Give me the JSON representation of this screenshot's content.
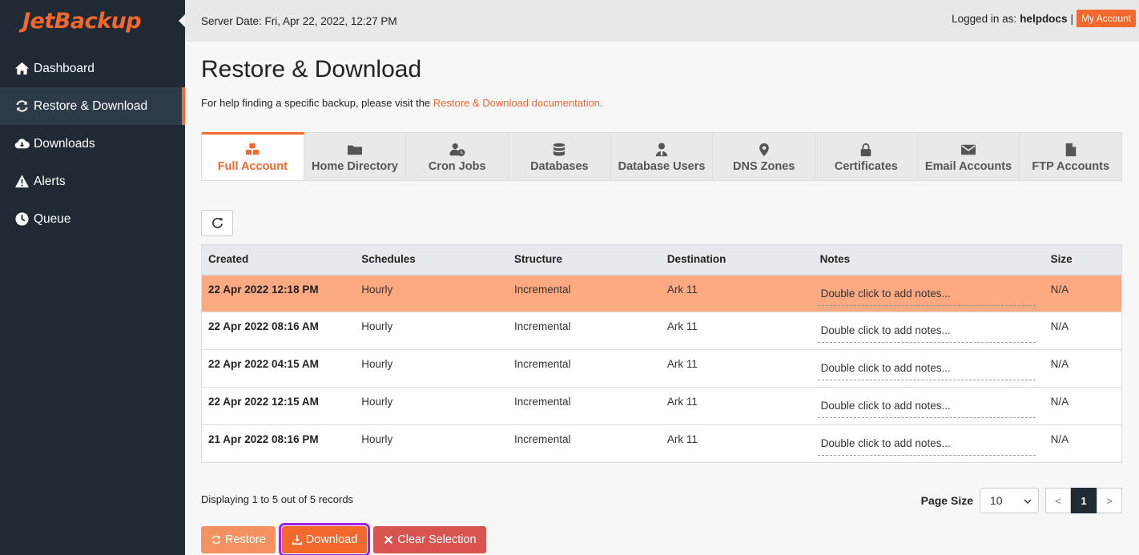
{
  "logo": "JetBackup",
  "sidebar": {
    "items": [
      {
        "label": "Dashboard",
        "icon": "home-icon"
      },
      {
        "label": "Restore & Download",
        "icon": "refresh-icon",
        "active": true
      },
      {
        "label": "Downloads",
        "icon": "cloud-download-icon"
      },
      {
        "label": "Alerts",
        "icon": "warning-icon"
      },
      {
        "label": "Queue",
        "icon": "clock-icon"
      }
    ]
  },
  "topbar": {
    "server_date": "Server Date: Fri, Apr 22, 2022, 12:27 PM",
    "logged_in_label": "Logged in as:",
    "username": "helpdocs",
    "separator": "|",
    "my_account": "My Account"
  },
  "page": {
    "title": "Restore & Download",
    "help_text": "For help finding a specific backup, please visit the",
    "help_link": "Restore & Download documentation."
  },
  "tabs": [
    {
      "label": "Full Account",
      "icon": "cubes-icon",
      "active": true
    },
    {
      "label": "Home Directory",
      "icon": "folder-icon"
    },
    {
      "label": "Cron Jobs",
      "icon": "user-clock-icon"
    },
    {
      "label": "Databases",
      "icon": "database-icon"
    },
    {
      "label": "Database Users",
      "icon": "user-tie-icon"
    },
    {
      "label": "DNS Zones",
      "icon": "map-marker-icon"
    },
    {
      "label": "Certificates",
      "icon": "lock-icon"
    },
    {
      "label": "Email Accounts",
      "icon": "envelope-icon"
    },
    {
      "label": "FTP Accounts",
      "icon": "file-icon"
    }
  ],
  "table": {
    "columns": [
      "Created",
      "Schedules",
      "Structure",
      "Destination",
      "Notes",
      "Size"
    ],
    "rows": [
      {
        "created": "22 Apr 2022 12:18 PM",
        "schedules": "Hourly",
        "structure": "Incremental",
        "destination": "Ark 11",
        "notes": "Double click to add notes...",
        "size": "N/A",
        "selected": true
      },
      {
        "created": "22 Apr 2022 08:16 AM",
        "schedules": "Hourly",
        "structure": "Incremental",
        "destination": "Ark 11",
        "notes": "Double click to add notes...",
        "size": "N/A"
      },
      {
        "created": "22 Apr 2022 04:15 AM",
        "schedules": "Hourly",
        "structure": "Incremental",
        "destination": "Ark 11",
        "notes": "Double click to add notes...",
        "size": "N/A"
      },
      {
        "created": "22 Apr 2022 12:15 AM",
        "schedules": "Hourly",
        "structure": "Incremental",
        "destination": "Ark 11",
        "notes": "Double click to add notes...",
        "size": "N/A"
      },
      {
        "created": "21 Apr 2022 08:16 PM",
        "schedules": "Hourly",
        "structure": "Incremental",
        "destination": "Ark 11",
        "notes": "Double click to add notes...",
        "size": "N/A"
      }
    ]
  },
  "footer": {
    "records": "Displaying 1 to 5 out of 5 records",
    "page_size_label": "Page Size",
    "page_size_value": "10",
    "prev": "<",
    "current_page": "1",
    "next": ">"
  },
  "actions": {
    "restore": "Restore",
    "download": "Download",
    "clear": "Clear Selection"
  },
  "colors": {
    "accent": "#f2682d",
    "sidebar": "#1f2a35",
    "selected_row": "#fdaa82",
    "clear_button": "#d9534f",
    "highlight_outline": "#a020f0"
  }
}
